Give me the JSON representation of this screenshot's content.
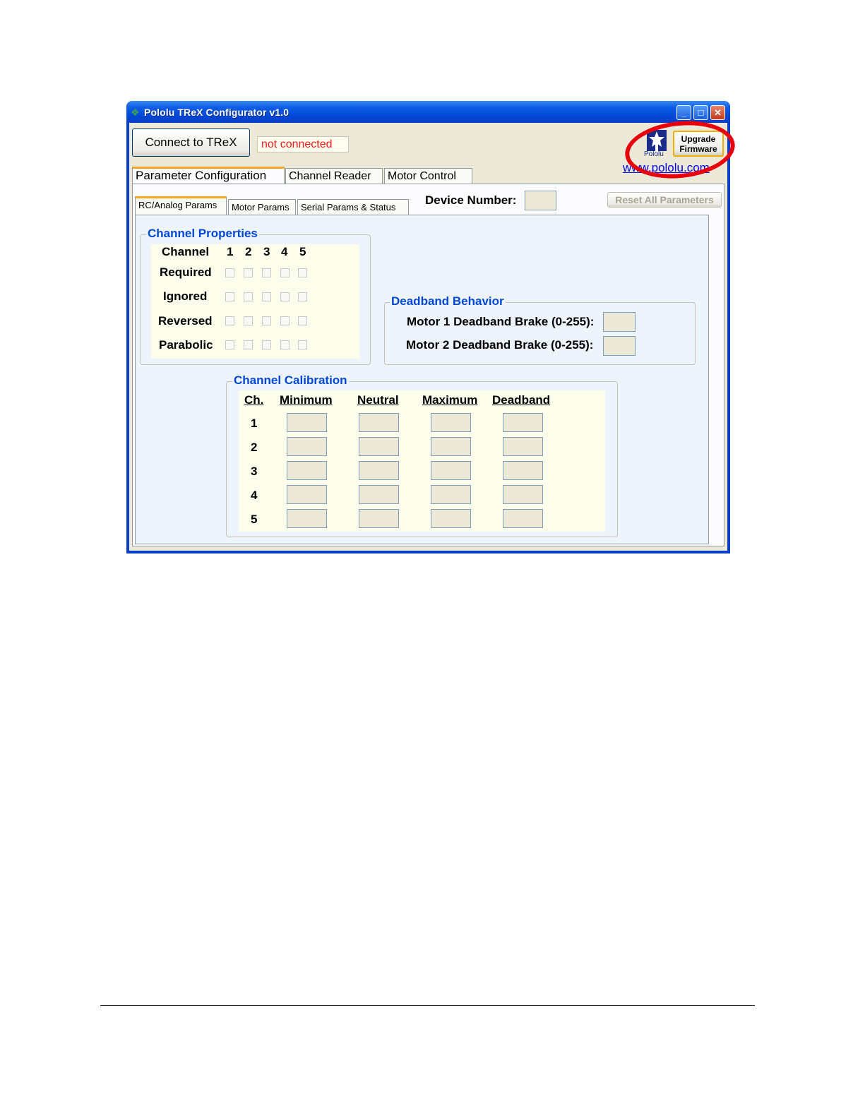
{
  "window": {
    "title": "Pololu TReX Configurator v1.0",
    "controls": {
      "minimize": "_",
      "maximize": "□",
      "close": "✕"
    }
  },
  "header": {
    "connect_label": "Connect to TReX",
    "status_text": "not connected",
    "logo_text": "Pololu",
    "upgrade_label_line1": "Upgrade",
    "upgrade_label_line2": "Firmware",
    "website": "www.pololu.com"
  },
  "tabs": [
    "Parameter Configuration",
    "Channel Reader",
    "Motor Control"
  ],
  "subtabs": [
    "RC/Analog Params",
    "Motor Params",
    "Serial Params & Status"
  ],
  "device_number_label": "Device Number:",
  "device_number_value": "",
  "reset_label": "Reset All Parameters",
  "channel_properties": {
    "title": "Channel Properties",
    "header_label": "Channel",
    "channels": [
      "1",
      "2",
      "3",
      "4",
      "5"
    ],
    "rows": [
      "Required",
      "Ignored",
      "Reversed",
      "Parabolic"
    ]
  },
  "deadband_behavior": {
    "title": "Deadband Behavior",
    "motor1_label": "Motor 1 Deadband Brake (0-255):",
    "motor2_label": "Motor 2 Deadband Brake (0-255):"
  },
  "channel_calibration": {
    "title": "Channel Calibration",
    "columns": [
      "Ch.",
      "Minimum",
      "Neutral",
      "Maximum",
      "Deadband"
    ],
    "rows": [
      "1",
      "2",
      "3",
      "4",
      "5"
    ]
  },
  "colors": {
    "accent_tab": "#f5a623",
    "status_text": "#ff1a1a",
    "group_title": "#0046d5",
    "annotation_circle": "#e8000b"
  }
}
